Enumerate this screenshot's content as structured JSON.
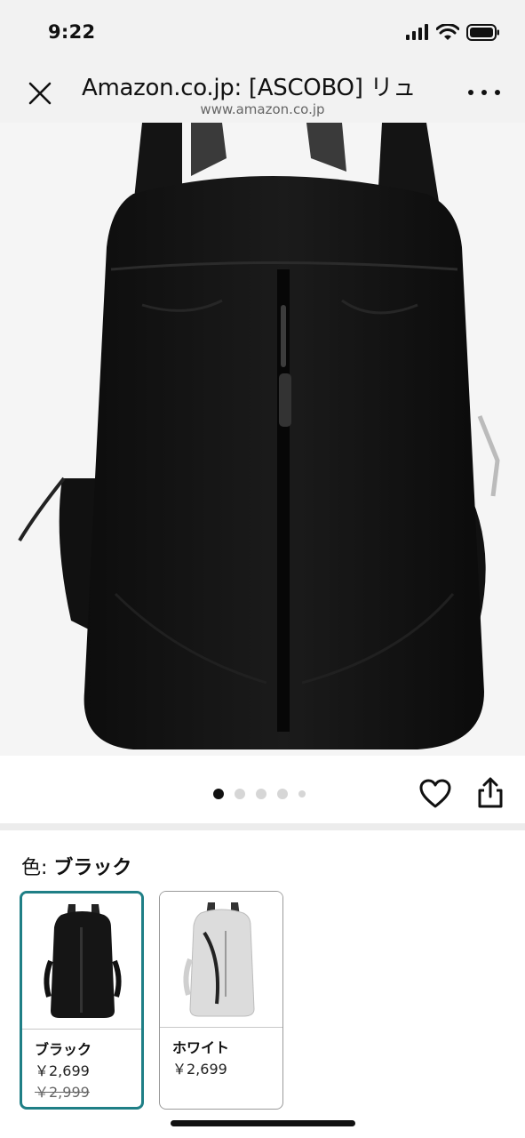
{
  "status": {
    "time": "9:22"
  },
  "browser": {
    "title": "Amazon.co.jp: [ASCOBO] リュ",
    "url": "www.amazon.co.jp"
  },
  "gallery": {
    "image_count": 5,
    "active_index": 0
  },
  "variant": {
    "label": "色:",
    "selected_name": "ブラック",
    "options": [
      {
        "name": "ブラック",
        "price": "￥2,699",
        "old_price": "￥2,999",
        "selected": true
      },
      {
        "name": "ホワイト",
        "price": "￥2,699",
        "selected": false
      }
    ]
  },
  "icons": {
    "close": "close-icon",
    "more": "more-icon",
    "heart": "heart-icon",
    "share": "share-icon",
    "signal": "signal-icon",
    "wifi": "wifi-icon",
    "battery": "battery-icon"
  },
  "colors": {
    "selected_border": "#1f7f86"
  }
}
